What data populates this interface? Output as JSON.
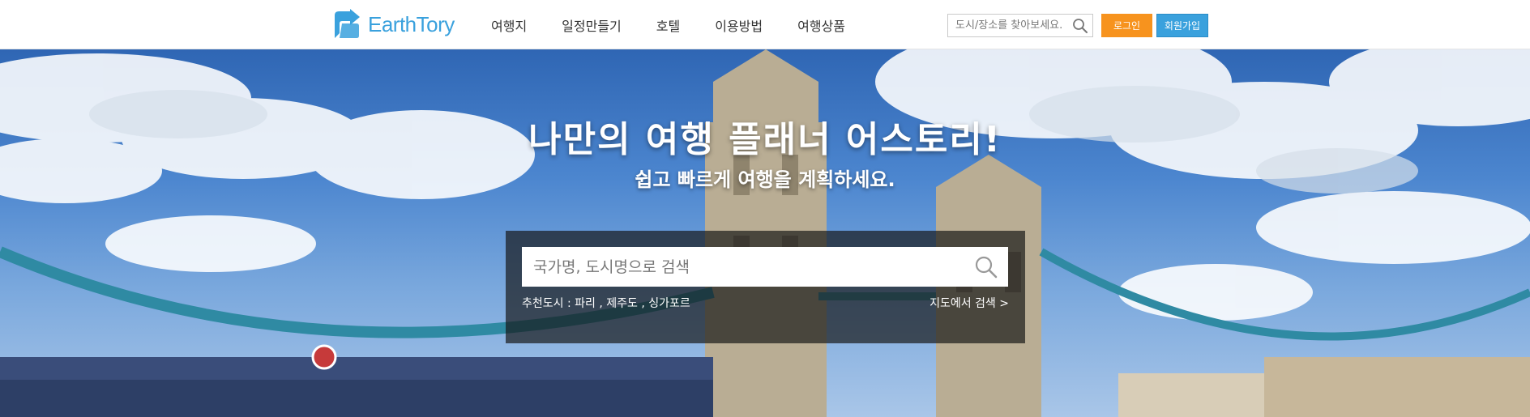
{
  "header": {
    "logo_text": "EarthTory",
    "brand_color": "#3aa1dd",
    "nav": [
      "여행지",
      "일정만들기",
      "호텔",
      "이용방법",
      "여행상품"
    ],
    "search_placeholder": "도시/장소를 찾아보세요.",
    "login_label": "로그인",
    "login_color": "#f7931e",
    "signup_label": "회원가입"
  },
  "hero": {
    "title": "나만의 여행 플래너 어스토리!",
    "subtitle": "쉽고 빠르게 여행을 계획하세요.",
    "search_placeholder": "국가명, 도시명으로 검색",
    "recommend_label": "추천도시 : ",
    "recommend_cities": [
      "파리",
      "제주도",
      "싱가포르"
    ],
    "map_search_label": "지도에서 검색 >"
  },
  "icons": {
    "logo": "logo-icon",
    "top_search": "search-icon",
    "main_search": "search-icon"
  }
}
